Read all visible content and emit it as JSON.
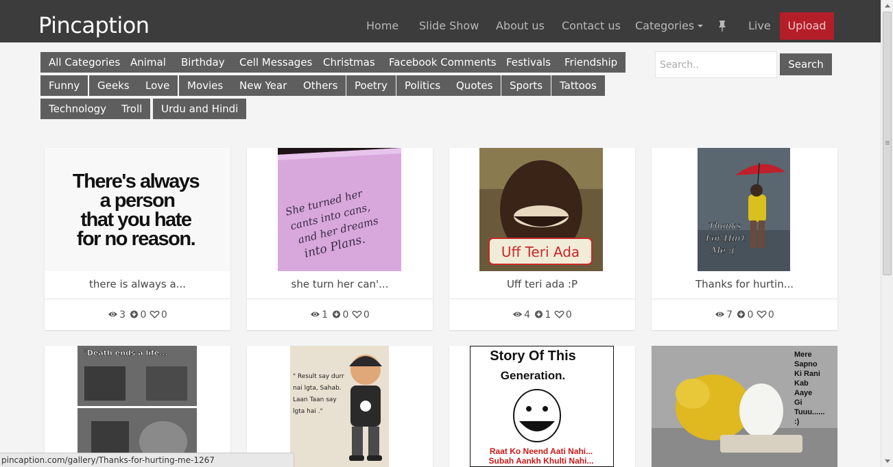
{
  "brand": "Pincaption",
  "nav": {
    "home": "Home",
    "slideshow": "Slide Show",
    "about": "About us",
    "contact": "Contact us",
    "categories": "Categories",
    "live": "Live",
    "upload": "Upload"
  },
  "categories": [
    "All Categories",
    "Animal",
    "Birthday",
    "Cell Messages",
    "Christmas",
    "Facebook Comments",
    "Festivals",
    "Friendship",
    "Funny",
    "Geeks",
    "Love",
    "Movies",
    "New Year",
    "Others",
    "Poetry",
    "Politics",
    "Quotes",
    "Sports",
    "Tattoos",
    "Technology",
    "Troll",
    "Urdu and Hindi"
  ],
  "search": {
    "placeholder": "Search..",
    "button": "Search"
  },
  "cards": [
    {
      "title": "there is always a...",
      "views": "3",
      "downloads": "0",
      "likes": "0",
      "image_text": [
        "There's always",
        "a person",
        "that you hate",
        "for no reason."
      ]
    },
    {
      "title": "she turn her can'...",
      "views": "1",
      "downloads": "0",
      "likes": "0",
      "image_text": [
        "She turned her",
        "cants into cans,",
        "and her dreams",
        "into Plans."
      ]
    },
    {
      "title": "Uff teri ada :P",
      "views": "4",
      "downloads": "1",
      "likes": "0",
      "image_text": [
        "Uff Teri Ada"
      ]
    },
    {
      "title": "Thanks for hurtin...",
      "views": "7",
      "downloads": "0",
      "likes": "0",
      "image_text": [
        "Thanks",
        "For Hurt",
        "Me :("
      ]
    }
  ],
  "row2_images": [
    {
      "image_text": [
        "\"Death ends a life..."
      ]
    },
    {
      "image_text": [
        "\" Result say durr",
        "nai lgta, Sahab.",
        "Laan Taan say",
        "lgta hai .\""
      ]
    },
    {
      "image_text": [
        "Story Of This",
        "Generation.",
        "Raat Ko Neend Aati Nahi...",
        "Subah Aankh Khulti Nahi..."
      ]
    },
    {
      "image_text": [
        "Mere",
        "Sapno",
        "Ki Rani",
        "Kab",
        "Aaye",
        "Gi",
        "Tuuu......",
        ":)"
      ]
    }
  ],
  "status_url": "pincaption.com/gallery/Thanks-for-hurting-me-1267",
  "colors": {
    "navbar": "#3c3c3c",
    "upload": "#b41e28",
    "category_button": "#5e5e5e",
    "background": "#f4f4f4"
  }
}
